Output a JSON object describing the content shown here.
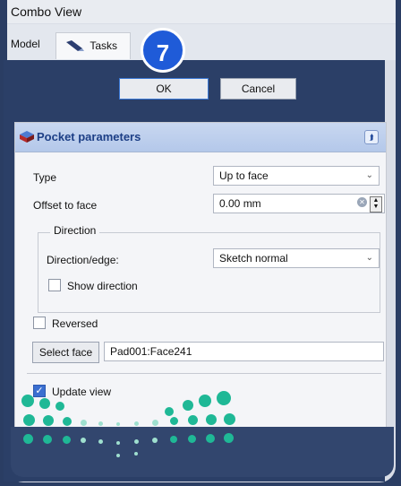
{
  "window": {
    "title": "Combo View"
  },
  "tabs": [
    {
      "label": "Model"
    },
    {
      "label": "Tasks"
    }
  ],
  "step_badge": "7",
  "dialog": {
    "ok_label": "OK",
    "cancel_label": "Cancel"
  },
  "pocket": {
    "title": "Pocket parameters",
    "type_label": "Type",
    "type_value": "Up to face",
    "offset_label": "Offset to face",
    "offset_value": "0.00 mm",
    "direction": {
      "group_title": "Direction",
      "edge_label": "Direction/edge:",
      "edge_value": "Sketch normal",
      "show_direction_label": "Show direction",
      "show_direction_checked": false
    },
    "reversed_label": "Reversed",
    "reversed_checked": false,
    "select_face_label": "Select face",
    "face_value": "Pad001:Face241",
    "update_view_label": "Update view",
    "update_view_checked": true
  },
  "colors": {
    "accent": "#1f5bd8",
    "header": "#b4c8ea",
    "background": "#2a3d63"
  }
}
